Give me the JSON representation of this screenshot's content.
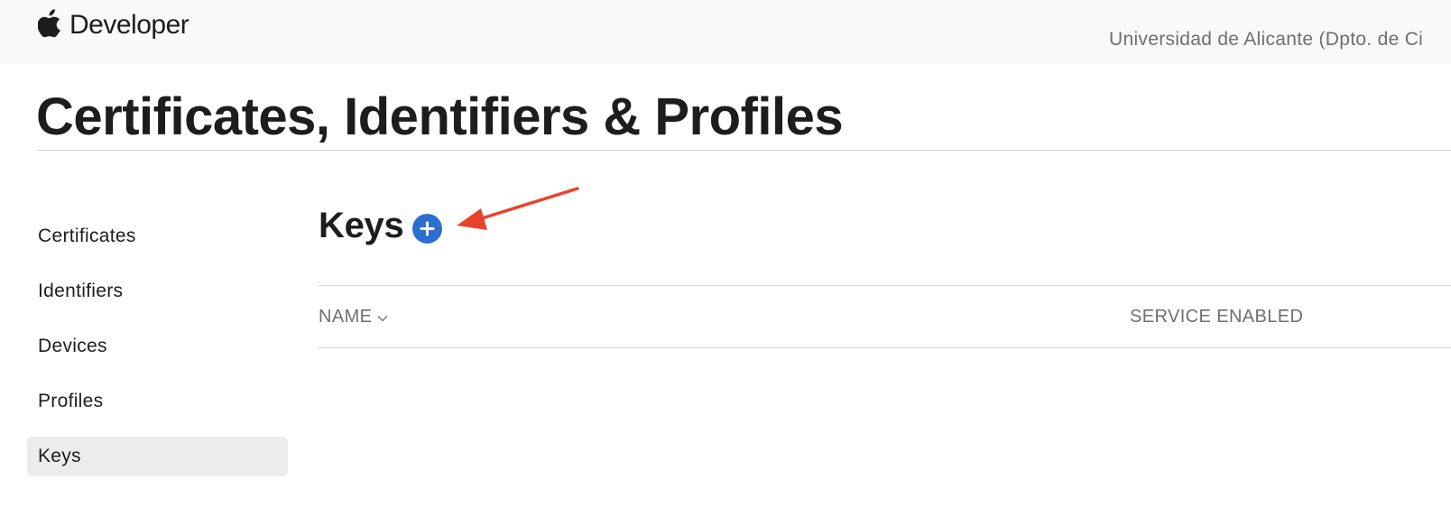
{
  "header": {
    "brand": "Developer",
    "account": "Universidad de Alicante (Dpto. de Ci"
  },
  "page": {
    "title": "Certificates, Identifiers & Profiles"
  },
  "sidebar": {
    "items": [
      {
        "label": "Certificates",
        "active": false
      },
      {
        "label": "Identifiers",
        "active": false
      },
      {
        "label": "Devices",
        "active": false
      },
      {
        "label": "Profiles",
        "active": false
      },
      {
        "label": "Keys",
        "active": true
      }
    ]
  },
  "section": {
    "title": "Keys",
    "add_icon": "plus-circle-icon"
  },
  "table": {
    "columns": [
      "NAME",
      "SERVICE ENABLED"
    ],
    "sort_icon": "chevron-down-icon",
    "rows": []
  },
  "colors": {
    "accent": "#2d6fcf",
    "annotation": "#e8432a",
    "topbar_bg": "#f9f9f9",
    "active_bg": "#ececec"
  }
}
